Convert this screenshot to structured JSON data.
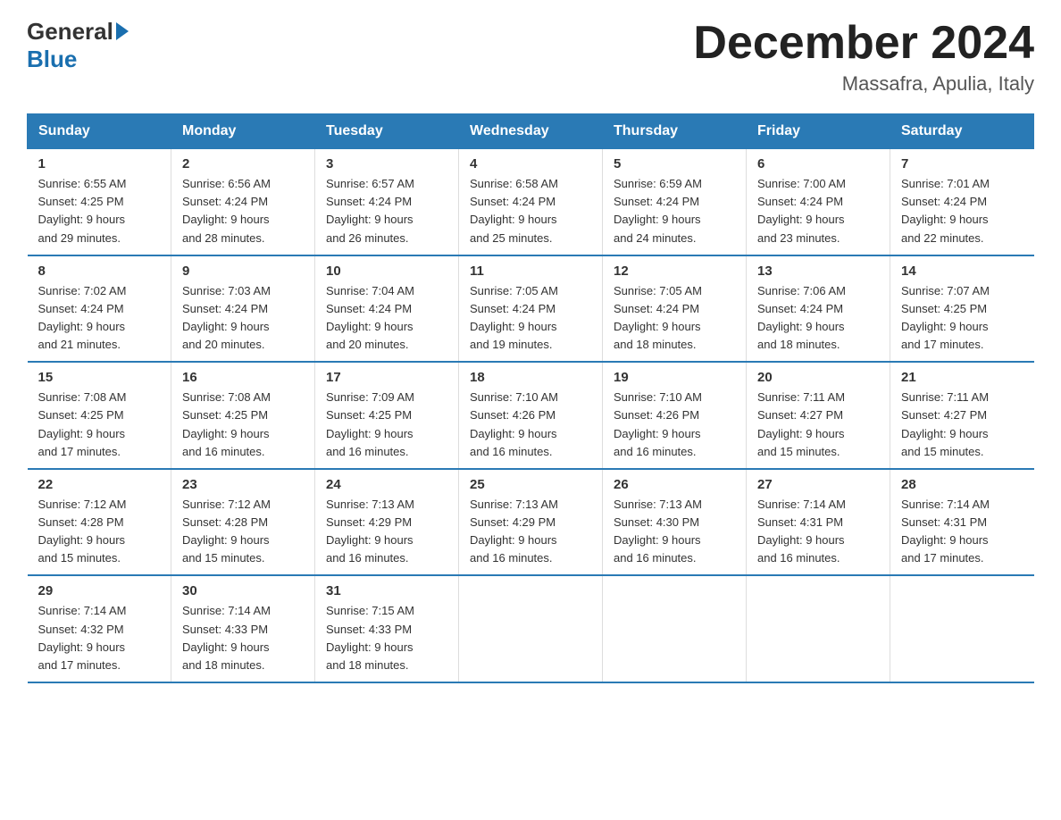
{
  "logo": {
    "general": "General",
    "blue": "Blue"
  },
  "header": {
    "month": "December 2024",
    "location": "Massafra, Apulia, Italy"
  },
  "days_of_week": [
    "Sunday",
    "Monday",
    "Tuesday",
    "Wednesday",
    "Thursday",
    "Friday",
    "Saturday"
  ],
  "weeks": [
    [
      {
        "day": "1",
        "sunrise": "6:55 AM",
        "sunset": "4:25 PM",
        "daylight": "9 hours and 29 minutes."
      },
      {
        "day": "2",
        "sunrise": "6:56 AM",
        "sunset": "4:24 PM",
        "daylight": "9 hours and 28 minutes."
      },
      {
        "day": "3",
        "sunrise": "6:57 AM",
        "sunset": "4:24 PM",
        "daylight": "9 hours and 26 minutes."
      },
      {
        "day": "4",
        "sunrise": "6:58 AM",
        "sunset": "4:24 PM",
        "daylight": "9 hours and 25 minutes."
      },
      {
        "day": "5",
        "sunrise": "6:59 AM",
        "sunset": "4:24 PM",
        "daylight": "9 hours and 24 minutes."
      },
      {
        "day": "6",
        "sunrise": "7:00 AM",
        "sunset": "4:24 PM",
        "daylight": "9 hours and 23 minutes."
      },
      {
        "day": "7",
        "sunrise": "7:01 AM",
        "sunset": "4:24 PM",
        "daylight": "9 hours and 22 minutes."
      }
    ],
    [
      {
        "day": "8",
        "sunrise": "7:02 AM",
        "sunset": "4:24 PM",
        "daylight": "9 hours and 21 minutes."
      },
      {
        "day": "9",
        "sunrise": "7:03 AM",
        "sunset": "4:24 PM",
        "daylight": "9 hours and 20 minutes."
      },
      {
        "day": "10",
        "sunrise": "7:04 AM",
        "sunset": "4:24 PM",
        "daylight": "9 hours and 20 minutes."
      },
      {
        "day": "11",
        "sunrise": "7:05 AM",
        "sunset": "4:24 PM",
        "daylight": "9 hours and 19 minutes."
      },
      {
        "day": "12",
        "sunrise": "7:05 AM",
        "sunset": "4:24 PM",
        "daylight": "9 hours and 18 minutes."
      },
      {
        "day": "13",
        "sunrise": "7:06 AM",
        "sunset": "4:24 PM",
        "daylight": "9 hours and 18 minutes."
      },
      {
        "day": "14",
        "sunrise": "7:07 AM",
        "sunset": "4:25 PM",
        "daylight": "9 hours and 17 minutes."
      }
    ],
    [
      {
        "day": "15",
        "sunrise": "7:08 AM",
        "sunset": "4:25 PM",
        "daylight": "9 hours and 17 minutes."
      },
      {
        "day": "16",
        "sunrise": "7:08 AM",
        "sunset": "4:25 PM",
        "daylight": "9 hours and 16 minutes."
      },
      {
        "day": "17",
        "sunrise": "7:09 AM",
        "sunset": "4:25 PM",
        "daylight": "9 hours and 16 minutes."
      },
      {
        "day": "18",
        "sunrise": "7:10 AM",
        "sunset": "4:26 PM",
        "daylight": "9 hours and 16 minutes."
      },
      {
        "day": "19",
        "sunrise": "7:10 AM",
        "sunset": "4:26 PM",
        "daylight": "9 hours and 16 minutes."
      },
      {
        "day": "20",
        "sunrise": "7:11 AM",
        "sunset": "4:27 PM",
        "daylight": "9 hours and 15 minutes."
      },
      {
        "day": "21",
        "sunrise": "7:11 AM",
        "sunset": "4:27 PM",
        "daylight": "9 hours and 15 minutes."
      }
    ],
    [
      {
        "day": "22",
        "sunrise": "7:12 AM",
        "sunset": "4:28 PM",
        "daylight": "9 hours and 15 minutes."
      },
      {
        "day": "23",
        "sunrise": "7:12 AM",
        "sunset": "4:28 PM",
        "daylight": "9 hours and 15 minutes."
      },
      {
        "day": "24",
        "sunrise": "7:13 AM",
        "sunset": "4:29 PM",
        "daylight": "9 hours and 16 minutes."
      },
      {
        "day": "25",
        "sunrise": "7:13 AM",
        "sunset": "4:29 PM",
        "daylight": "9 hours and 16 minutes."
      },
      {
        "day": "26",
        "sunrise": "7:13 AM",
        "sunset": "4:30 PM",
        "daylight": "9 hours and 16 minutes."
      },
      {
        "day": "27",
        "sunrise": "7:14 AM",
        "sunset": "4:31 PM",
        "daylight": "9 hours and 16 minutes."
      },
      {
        "day": "28",
        "sunrise": "7:14 AM",
        "sunset": "4:31 PM",
        "daylight": "9 hours and 17 minutes."
      }
    ],
    [
      {
        "day": "29",
        "sunrise": "7:14 AM",
        "sunset": "4:32 PM",
        "daylight": "9 hours and 17 minutes."
      },
      {
        "day": "30",
        "sunrise": "7:14 AM",
        "sunset": "4:33 PM",
        "daylight": "9 hours and 18 minutes."
      },
      {
        "day": "31",
        "sunrise": "7:15 AM",
        "sunset": "4:33 PM",
        "daylight": "9 hours and 18 minutes."
      },
      null,
      null,
      null,
      null
    ]
  ],
  "labels": {
    "sunrise": "Sunrise:",
    "sunset": "Sunset:",
    "daylight": "Daylight:"
  }
}
